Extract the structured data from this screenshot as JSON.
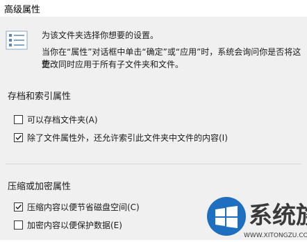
{
  "dialog": {
    "title": "高级属性"
  },
  "intro": {
    "line1": "为该文件夹选择你想要的设置。",
    "line2": "当你在“属性”对话框中单击“确定”或“应用”时，系统会询问你是否将这些",
    "line3": "更改同时应用于所有子文件夹和文件。"
  },
  "archive_group": {
    "label": "存档和索引属性",
    "items": [
      {
        "label": "可以存档文件夹(A)",
        "checked": false
      },
      {
        "label": "除了文件属性外，还允许索引此文件夹中文件的内容(I)",
        "checked": true
      }
    ]
  },
  "compress_group": {
    "label": "压缩或加密属性",
    "items": [
      {
        "label": "压缩内容以便节省磁盘空间(C)",
        "checked": true
      },
      {
        "label": "加密内容以便保护数据(E)",
        "checked": false
      }
    ]
  },
  "watermark": {
    "brand": "系统族",
    "url": "WWW.XITONGZU.COM",
    "colors": {
      "blue": "#1e6fc0",
      "text": "#3a3a3a"
    }
  }
}
